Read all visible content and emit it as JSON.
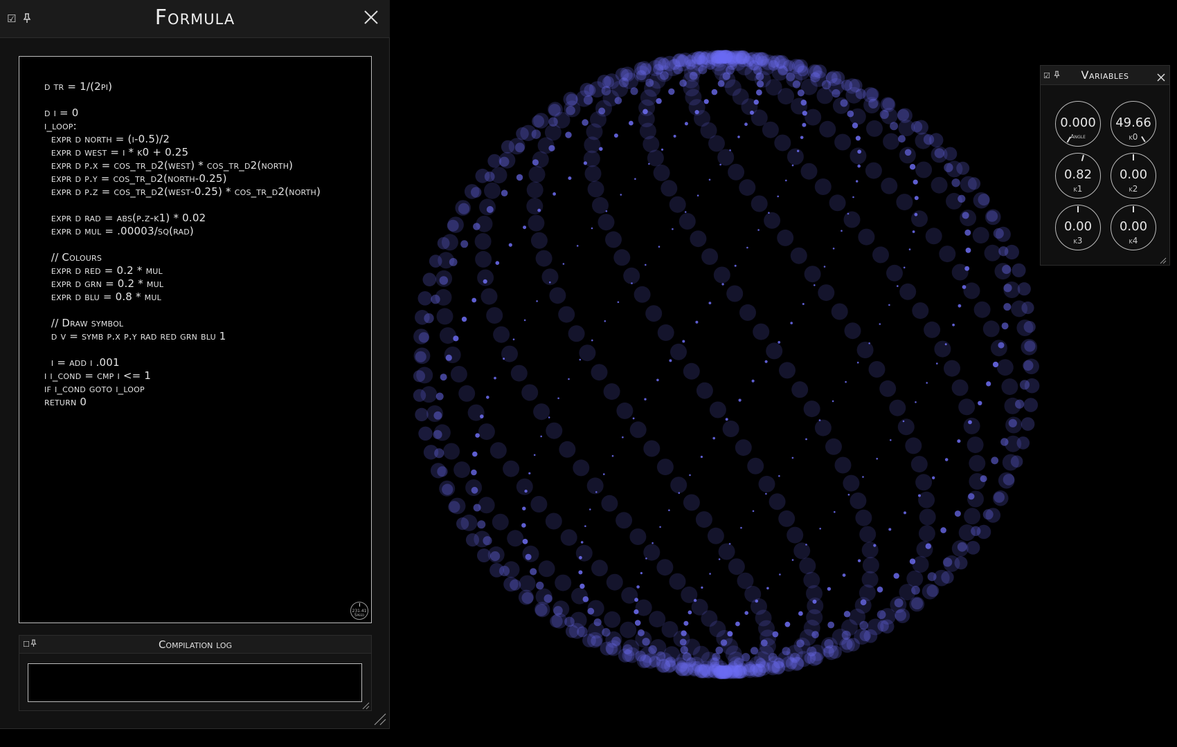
{
  "formula_window": {
    "title": "Formula",
    "code_lines": [
      "d tr = 1/(2pi)",
      "",
      "d i = 0",
      "i_loop:",
      "  expr d north = (i-0.5)/2",
      "  expr d west = i * k0 + 0.25",
      "  expr d p.x = cos_tr_d2(west) * cos_tr_d2(north)",
      "  expr d p.y = cos_tr_d2(north-0.25)",
      "  expr d p.z = cos_tr_d2(west-0.25) * cos_tr_d2(north)",
      "",
      "  expr d rad = abs(p.z-k1) * 0.02",
      "  expr d mul = .00003/sq(rad)",
      "",
      "  // Colours",
      "  expr d red = 0.2 * mul",
      "  expr d grn = 0.2 * mul",
      "  expr d blu = 0.8 * mul",
      "",
      "  // Draw symbol",
      "  d v = symb p.x p.y rad red grn blu 1",
      "",
      "  i = add i .001",
      "i i_cond = cmp i <= 1",
      "if i_cond goto i_loop",
      "return 0"
    ],
    "speed_dial": {
      "value": "231.41",
      "label": "Speed"
    },
    "compilation_log": {
      "title": "Compilation log",
      "output": ""
    }
  },
  "variables_window": {
    "title": "Variables",
    "knobs": [
      {
        "label": "Angle",
        "value": "0.000",
        "position": 0.0
      },
      {
        "label": "k0",
        "value": "49.66",
        "position": 0.99
      },
      {
        "label": "k1",
        "value": "0.82",
        "position": 0.55
      },
      {
        "label": "k2",
        "value": "0.00",
        "position": 0.5
      },
      {
        "label": "k3",
        "value": "0.00",
        "position": 0.5
      },
      {
        "label": "k4",
        "value": "0.00",
        "position": 0.5
      }
    ]
  },
  "render": {
    "background": "#000000",
    "point_color": "#6e6ef5",
    "points_count": 1000,
    "k0": 49.66,
    "k1": 0.82
  }
}
